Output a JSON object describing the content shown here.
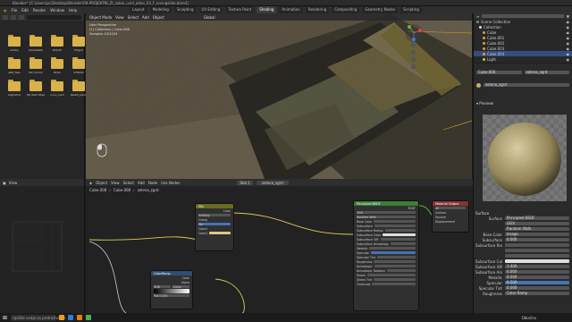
{
  "titlebar": {
    "title": "Blender* [C:\\Users\\pc\\Desktop\\Blender\\09-PROJEKTNI_ZI_sabni_uvid_odno_03_F_lovingslide.blend]"
  },
  "menu": [
    "File",
    "Edit",
    "Render",
    "Window",
    "Help"
  ],
  "workspaces": [
    "Layout",
    "Modeling",
    "Sculpting",
    "UV Editing",
    "Texture Paint",
    "Shading",
    "Animation",
    "Rendering",
    "Compositing",
    "Geometry Nodes",
    "Scripting"
  ],
  "active_workspace": "Shading",
  "filebrowser": {
    "folders": [
      "Adobe",
      "AdobeWeb",
      "DOLCE",
      "Edged",
      "eRZ_files",
      "IKC Comm",
      "Rider",
      "STUDIO",
      "Lightshot",
      "My Web Sites",
      "novo_nam",
      "Paketi_plecit"
    ]
  },
  "viewport": {
    "header_items": [
      "Object Mode",
      "View",
      "Select",
      "Add",
      "Object",
      "Global"
    ],
    "info_lines": [
      "User Perspective",
      "(1) Collection | Cube.008",
      "Samples 10/1024"
    ],
    "gizmo_labels": [
      "X",
      "Y",
      "Z"
    ]
  },
  "outliner": {
    "rows": [
      "Scene Collection",
      "Collection",
      "Cube",
      "Cube.001",
      "Cube.002",
      "Cube.003",
      "Cube.004",
      "Light"
    ]
  },
  "props": {
    "object": "Cube.008",
    "material": "zelena_zgrd",
    "material2": "zelena_zgrd",
    "section_surface": "Surface",
    "surface_label": "Surface",
    "surface_value": "Principled BSDF",
    "rows": [
      {
        "label": "",
        "value": "GGX"
      },
      {
        "label": "",
        "value": "Random Walk"
      },
      {
        "label": "Base Color",
        "value": "Image"
      },
      {
        "label": "Subsurface",
        "value": "0.000"
      },
      {
        "label": "Subsurface Radius",
        "value": ""
      },
      {
        "label": "",
        "value": ""
      },
      {
        "label": "",
        "value": ""
      },
      {
        "label": "Subsurface Color",
        "value": ""
      },
      {
        "label": "Subsurface IOR",
        "value": "1.400"
      },
      {
        "label": "Subsurface Anisotropy",
        "value": "0.000"
      },
      {
        "label": "Metallic",
        "value": "0.000"
      },
      {
        "label": "Specular",
        "value": "0.500"
      },
      {
        "label": "Specular Tint",
        "value": "0.000"
      },
      {
        "label": "Roughness",
        "value": "Color Ramp"
      }
    ]
  },
  "node_editor": {
    "header": [
      "Object",
      "View",
      "Select",
      "Add",
      "Node",
      "Use Nodes"
    ],
    "slot": "Slot 1",
    "material": "zelena_zgrd",
    "breadcrumbs": [
      "Cube.008",
      "Cube.008",
      "zelena_zgrd"
    ],
    "nodes": {
      "mix": {
        "title": "Mix",
        "rows": [
          "Color",
          "Multiply",
          "Clamp",
          "Fac",
          "Color1",
          "Color2"
        ]
      },
      "ramp": {
        "title": "ColorRamp",
        "rows": [
          "Color",
          "Alpha",
          "RGB",
          "Linear",
          "Pos 0.000"
        ]
      },
      "bsdf": {
        "title": "Principled BSDF",
        "rows": [
          "BSDF",
          "GGX",
          "Random Walk",
          "Base Color",
          "Subsurface",
          "Subsurface Radius",
          "Subsurface Color",
          "Subsurface IOR",
          "Subsurface Anisotropy",
          "Metallic",
          "Specular",
          "Specular Tint",
          "Roughness",
          "Anisotropic",
          "Anisotropic Rotation",
          "Sheen",
          "Sheen Tint",
          "Clearcoat"
        ]
      },
      "output": {
        "title": "Material Output",
        "rows": [
          "All",
          "Surface",
          "Volume",
          "Displacement"
        ]
      }
    }
  },
  "statusbar": {
    "search": "Upišite ovdje za pretraživanje",
    "weather": "Oblačno"
  },
  "colors": {
    "folder": "#d9b24a",
    "accent": "#4772b3",
    "node_green": "#3e7d3a",
    "node_red": "#8a3333",
    "node_mix": "#6a6a1f",
    "node_blue": "#2d4f72"
  }
}
